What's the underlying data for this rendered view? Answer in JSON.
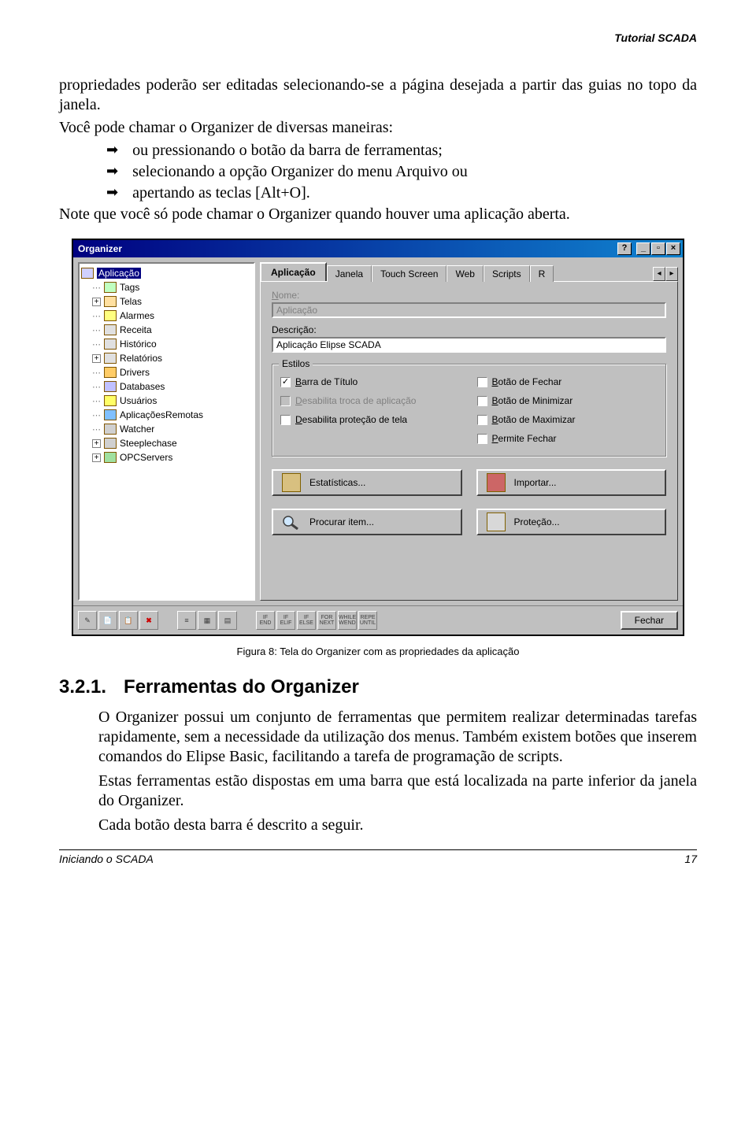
{
  "header": {
    "doc_title": "Tutorial SCADA"
  },
  "intro": {
    "p1": "propriedades poderão ser editadas selecionando-se a página desejada a partir das guias no topo da janela.",
    "p2": "Você pode chamar o Organizer de diversas maneiras:",
    "bullets": [
      "ou pressionando o botão   da barra de ferramentas;",
      "selecionando a opção Organizer do menu Arquivo ou",
      "apertando as teclas [Alt+O]."
    ],
    "p3": "Note que você só pode chamar o Organizer quando houver uma aplicação aberta."
  },
  "organizer": {
    "title": "Organizer",
    "titlebar_buttons": {
      "help": "?",
      "min": "_",
      "max": "▫",
      "close": "×"
    },
    "tree": [
      {
        "expand": "",
        "icon": "app-icon",
        "label": "Aplicação",
        "selected": true,
        "indent": 0
      },
      {
        "expand": "",
        "icon": "tags-icon",
        "label": "Tags",
        "indent": 1
      },
      {
        "expand": "+",
        "icon": "screens-icon",
        "label": "Telas",
        "indent": 1
      },
      {
        "expand": "",
        "icon": "alarms-icon",
        "label": "Alarmes",
        "indent": 1
      },
      {
        "expand": "",
        "icon": "recipe-icon",
        "label": "Receita",
        "indent": 1
      },
      {
        "expand": "",
        "icon": "history-icon",
        "label": "Histórico",
        "indent": 1
      },
      {
        "expand": "+",
        "icon": "reports-icon",
        "label": "Relatórios",
        "indent": 1
      },
      {
        "expand": "",
        "icon": "drivers-icon",
        "label": "Drivers",
        "indent": 1
      },
      {
        "expand": "",
        "icon": "db-icon",
        "label": "Databases",
        "indent": 1
      },
      {
        "expand": "",
        "icon": "users-icon",
        "label": "Usuários",
        "indent": 1
      },
      {
        "expand": "",
        "icon": "remote-icon",
        "label": "AplicaçõesRemotas",
        "indent": 1
      },
      {
        "expand": "",
        "icon": "watcher-icon",
        "label": "Watcher",
        "indent": 1
      },
      {
        "expand": "+",
        "icon": "steeple-icon",
        "label": "Steeplechase",
        "indent": 1
      },
      {
        "expand": "+",
        "icon": "opc-icon",
        "label": "OPCServers",
        "indent": 1
      }
    ],
    "tabs": {
      "items": [
        "Aplicação",
        "Janela",
        "Touch Screen",
        "Web",
        "Scripts",
        "R"
      ],
      "active": 0,
      "scroll_left": "◂",
      "scroll_right": "▸"
    },
    "panel": {
      "name_label": "Nome:",
      "name_value": "Aplicação",
      "desc_label": "Descrição:",
      "desc_value": "Aplicação Elipse SCADA",
      "styles_title": "Estilos",
      "left_checks": [
        {
          "checked": true,
          "enabled": true,
          "label": "Barra de Título"
        },
        {
          "checked": false,
          "enabled": false,
          "label": "Desabilita troca de aplicação"
        },
        {
          "checked": false,
          "enabled": true,
          "label": "Desabilita proteção de tela"
        }
      ],
      "right_checks": [
        {
          "checked": false,
          "enabled": true,
          "label": "Botão de Fechar"
        },
        {
          "checked": false,
          "enabled": true,
          "label": "Botão de Minimizar"
        },
        {
          "checked": false,
          "enabled": true,
          "label": "Botão de Maximizar"
        },
        {
          "checked": false,
          "enabled": true,
          "label": "Permite Fechar"
        }
      ],
      "buttons": {
        "stats": "Estatísticas...",
        "import": "Importar...",
        "find": "Procurar item...",
        "protect": "Proteção..."
      }
    },
    "toolbar": {
      "edit_group": [
        "✎",
        "📄",
        "📋",
        "✖"
      ],
      "misc_group": [
        "≡",
        "▦",
        "▤"
      ],
      "script_group": [
        {
          "top": "IF",
          "bot": "END"
        },
        {
          "top": "IF",
          "bot": "ELIF"
        },
        {
          "top": "IF",
          "bot": "ELSE"
        },
        {
          "top": "FOR",
          "bot": "NEXT"
        },
        {
          "top": "WHILE",
          "bot": "WEND"
        },
        {
          "top": "REPE",
          "bot": "UNTIL"
        }
      ],
      "close": "Fechar"
    }
  },
  "caption": "Figura 8: Tela do Organizer com as propriedades da aplicação",
  "section": {
    "num": "3.2.1.",
    "title": "Ferramentas do Organizer",
    "p1": "O Organizer possui um conjunto de ferramentas que permitem realizar determinadas tarefas rapidamente, sem a necessidade da utilização dos menus. Também existem botões que inserem comandos do Elipse Basic, facilitando a tarefa de programação de scripts.",
    "p2": "Estas ferramentas estão dispostas em uma barra que está localizada na parte inferior da janela do Organizer.",
    "p3": "Cada botão desta barra é descrito a seguir."
  },
  "footer": {
    "left": "Iniciando o SCADA",
    "right": "17"
  }
}
